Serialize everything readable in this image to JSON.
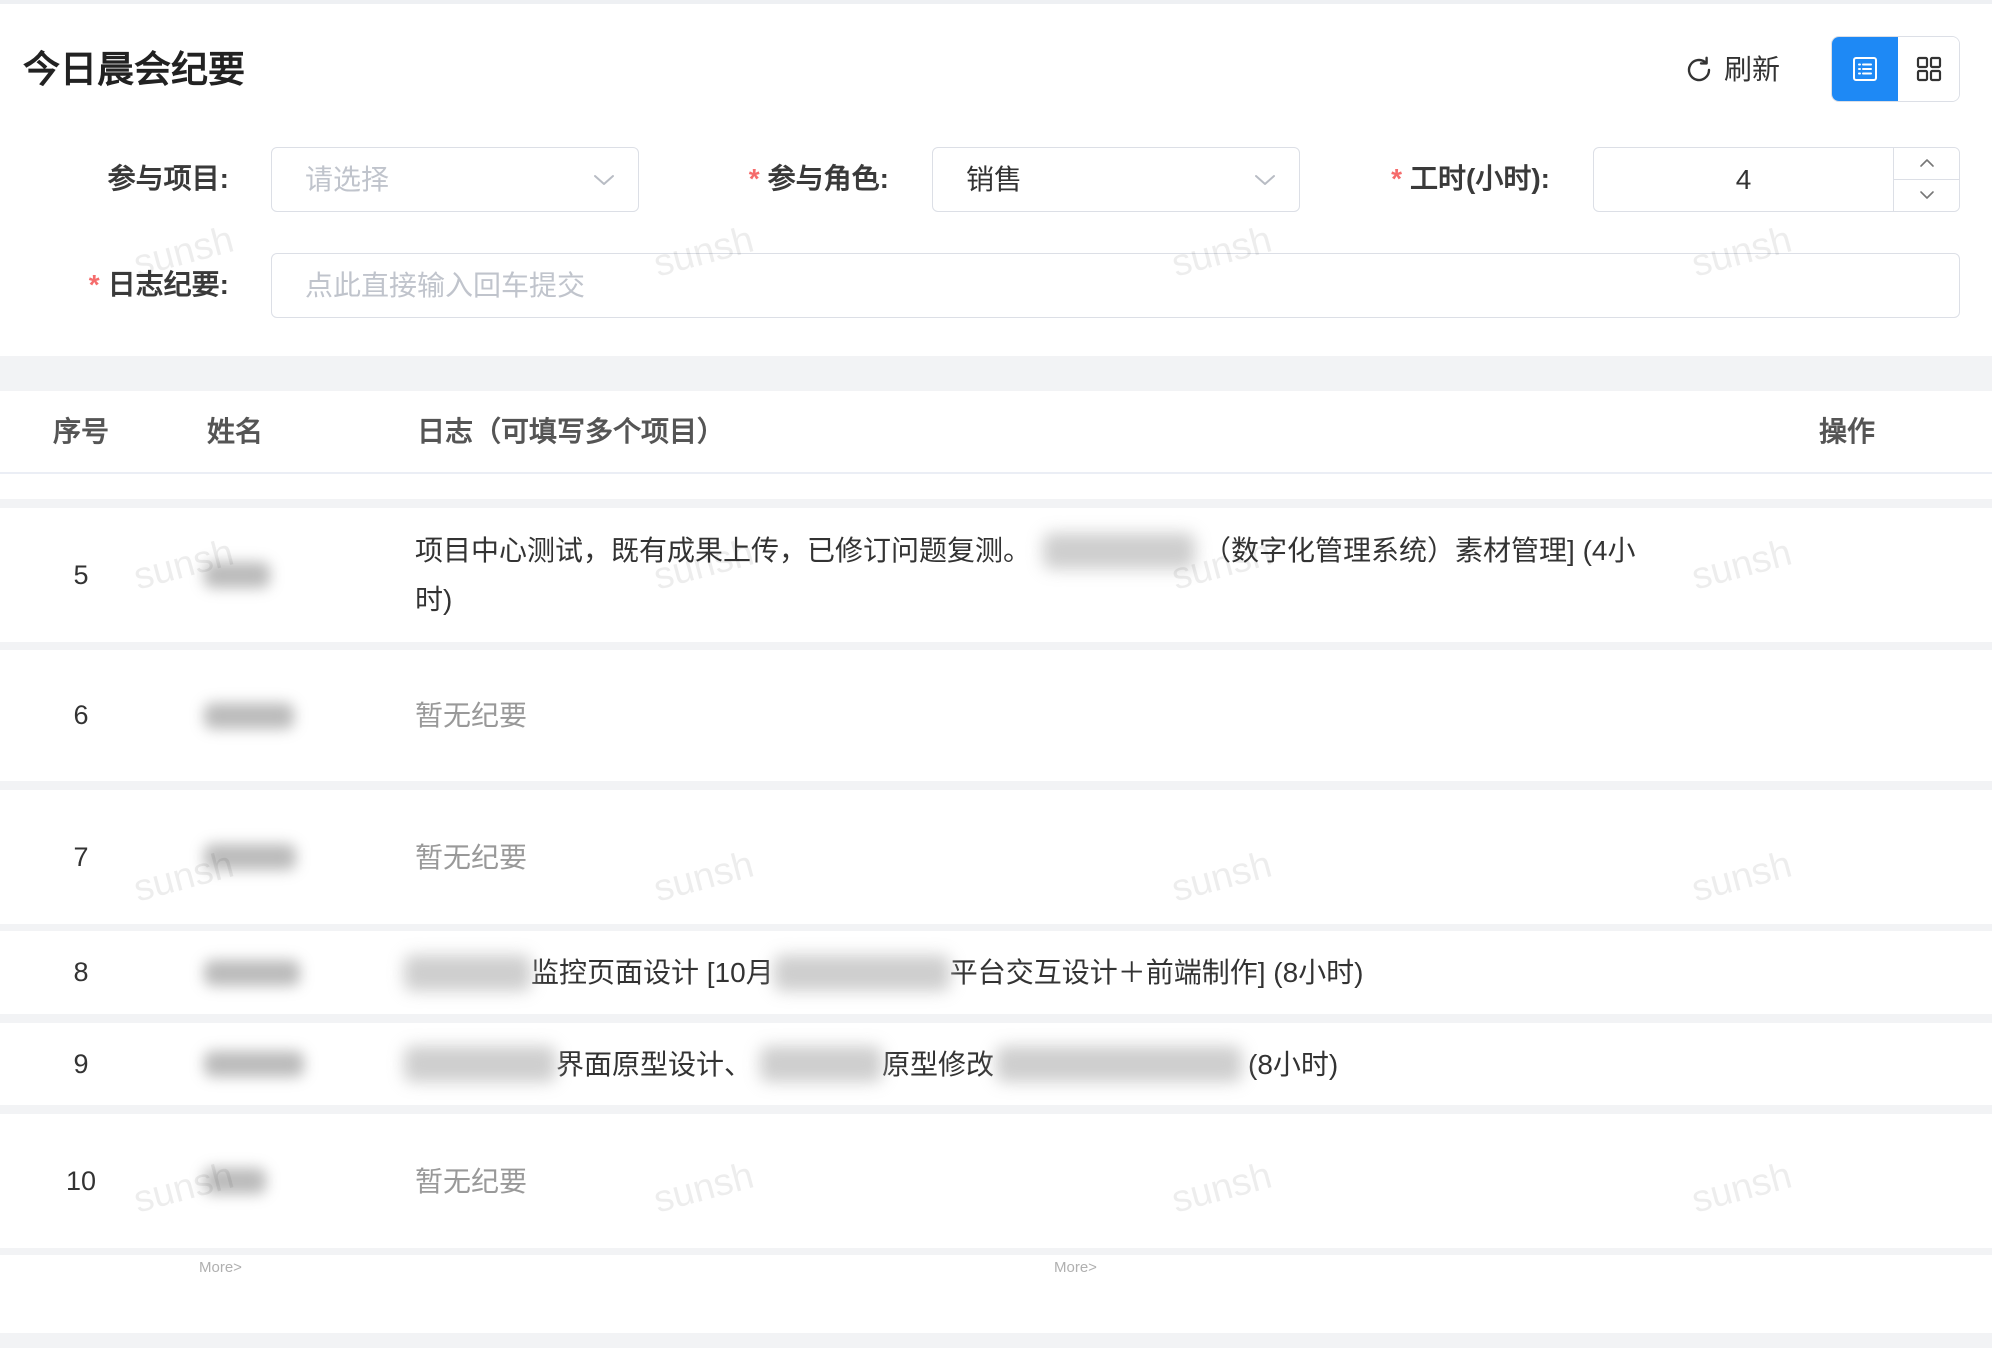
{
  "page": {
    "title": "今日晨会纪要"
  },
  "toolbar": {
    "refresh_label": "刷新",
    "list_view_active": true,
    "icons": {
      "refresh": "refresh-icon",
      "list_view": "list-view-icon",
      "grid_view": "grid-view-icon"
    }
  },
  "form": {
    "required_mark": "*",
    "project": {
      "label": "参与项目:",
      "placeholder": "请选择",
      "required": false
    },
    "role": {
      "label": "参与角色:",
      "value": "销售",
      "required": true
    },
    "hours": {
      "label": "工时(小时):",
      "value": "4",
      "required": true
    },
    "log": {
      "label": "日志纪要:",
      "placeholder": "点此直接输入回车提交",
      "required": true
    }
  },
  "table": {
    "columns": [
      "序号",
      "姓名",
      "日志（可填写多个项目）",
      "操作"
    ],
    "empty_log_text": "暂无纪要",
    "rows": [
      {
        "index": "5",
        "log": {
          "text1": "项目中心测试，既有成果上传，已修订问题复测。",
          "text2": "（数字化管理系统）素材管理] (4小",
          "text3": "时)"
        }
      },
      {
        "index": "6"
      },
      {
        "index": "7"
      },
      {
        "index": "8",
        "log": {
          "text1": "监控页面设计 [10月",
          "text2": "平台交互设计＋前端制作] (8小时)"
        }
      },
      {
        "index": "9",
        "log": {
          "text1": "界面原型设计、",
          "text2": "原型修改",
          "text3": "(8小时)"
        }
      },
      {
        "index": "10"
      }
    ],
    "more_label": "More>"
  },
  "watermark": {
    "text": "sunsh"
  },
  "colors": {
    "accent": "#1e89f5",
    "required": "#f56c6c",
    "placeholder": "#c0c4cc",
    "muted_text": "#999999",
    "separator": "#f2f3f5",
    "border": "#dcdfe6"
  }
}
